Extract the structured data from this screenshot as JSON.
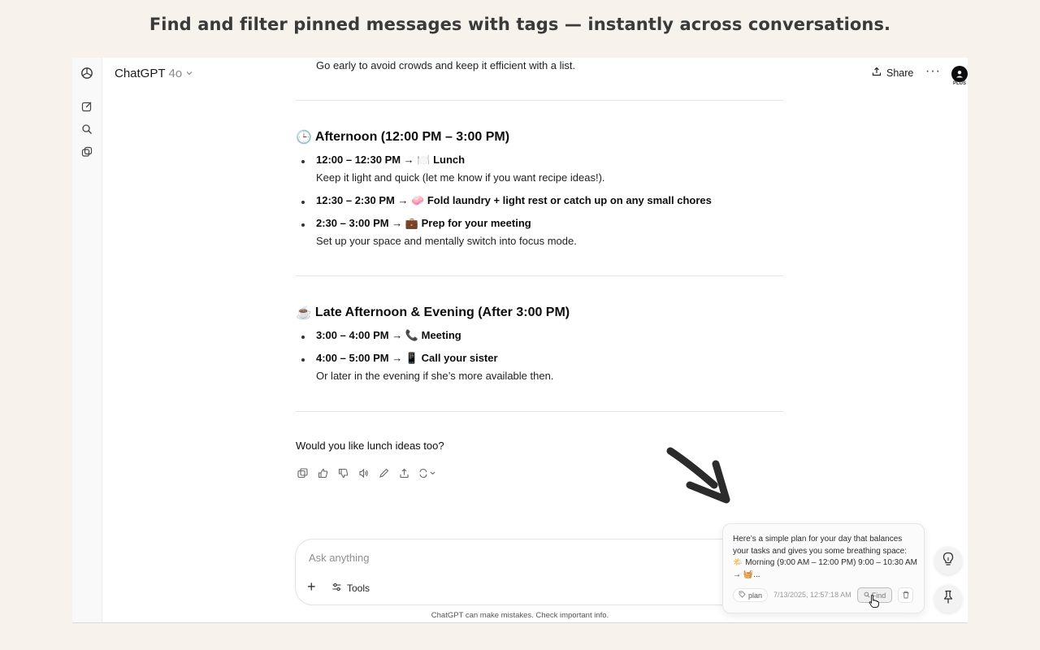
{
  "headline": "Find and filter pinned messages with tags — instantly across conversations.",
  "header": {
    "app_name": "ChatGPT",
    "model": "4o",
    "share_label": "Share",
    "plan_badge": "PLUS"
  },
  "chat": {
    "top_line": "Go early to avoid crowds and keep it efficient with a list.",
    "sections": [
      {
        "emoji": "🕒",
        "title": "Afternoon (12:00 PM – 3:00 PM)",
        "items": [
          {
            "time": "12:00 – 12:30 PM → 🍽️ Lunch",
            "sub": "Keep it light and quick (let me know if you want recipe ideas!)."
          },
          {
            "time": "12:30 – 2:30 PM → 🧼 Fold laundry + light rest or catch up on any small chores",
            "sub": ""
          },
          {
            "time": "2:30 – 3:00 PM → 💼 Prep for your meeting",
            "sub": "Set up your space and mentally switch into focus mode."
          }
        ]
      },
      {
        "emoji": "☕",
        "title": "Late Afternoon & Evening (After 3:00 PM)",
        "items": [
          {
            "time": "3:00 – 4:00 PM → 📞 Meeting",
            "sub": ""
          },
          {
            "time": "4:00 – 5:00 PM → 📱 Call your sister",
            "sub": "Or later in the evening if she’s more available then."
          }
        ]
      }
    ],
    "question": "Would you like lunch ideas too?"
  },
  "composer": {
    "placeholder": "Ask anything",
    "tools_label": "Tools",
    "disclaimer": "ChatGPT can make mistakes. Check important info."
  },
  "pinned_popup": {
    "text": "Here’s a simple plan for your day that balances your tasks and gives you some breathing space: 🌤️ Morning (9:00 AM – 12:00 PM) 9:00 – 10:30 AM → 🧺...",
    "tag": "plan",
    "timestamp": "7/13/2025, 12:57:18 AM",
    "find_label": "Find"
  },
  "icons": {
    "rail": [
      "openai-logo-icon",
      "new-chat-icon",
      "search-icon",
      "library-icon"
    ],
    "floating": [
      "lightbulb-icon",
      "pin-icon"
    ]
  }
}
